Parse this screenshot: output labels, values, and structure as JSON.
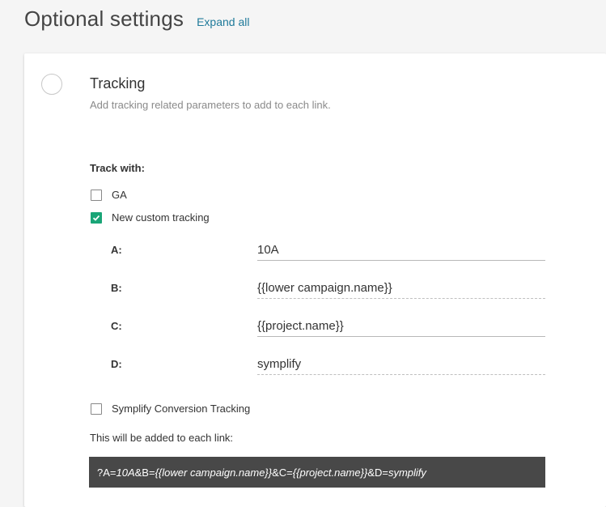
{
  "header": {
    "title": "Optional settings",
    "expand_all": "Expand all"
  },
  "tracking": {
    "title": "Tracking",
    "description": "Add tracking related parameters to add to each link.",
    "track_with_label": "Track with:",
    "options": [
      {
        "label": "GA",
        "checked": false
      },
      {
        "label": "New custom tracking",
        "checked": true
      }
    ],
    "params": [
      {
        "key": "A:",
        "value": "10A"
      },
      {
        "key": "B:",
        "value": "{{lower campaign.name}}"
      },
      {
        "key": "C:",
        "value": "{{project.name}}"
      },
      {
        "key": "D:",
        "value": "symplify"
      }
    ],
    "conversion_tracking": {
      "label": "Symplify Conversion Tracking",
      "checked": false
    },
    "added_label": "This will be added to each link:",
    "result": {
      "p0": "?A=",
      "v0": "10A",
      "p1": "&B=",
      "v1": "{{lower campaign.name}}",
      "p2": "&C=",
      "v2": "{{project.name}}",
      "p3": "&D=",
      "v3": "symplify"
    }
  },
  "colors": {
    "accent_link": "#1f7a9a",
    "checkbox_checked": "#1aa577",
    "result_bg": "#484848"
  }
}
